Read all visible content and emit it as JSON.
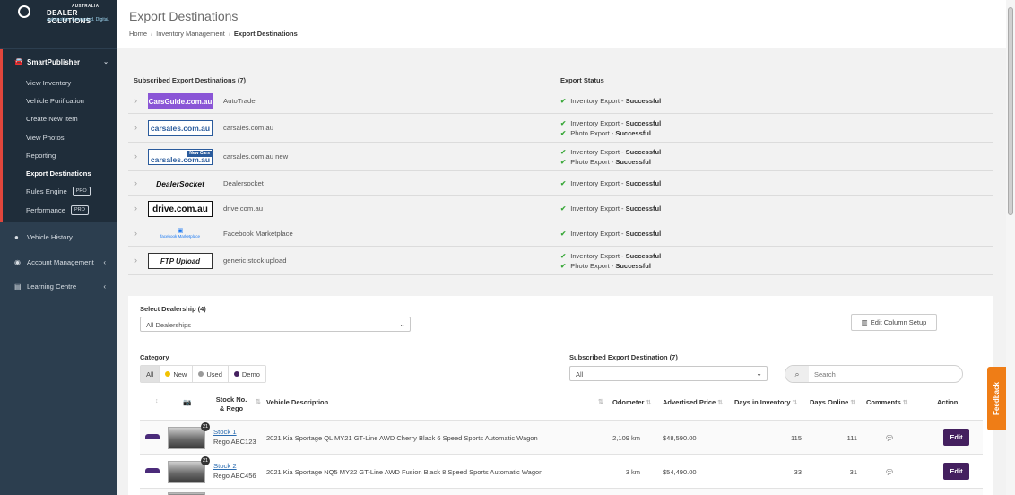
{
  "brand": {
    "country": "AUSTRALIA",
    "name": "DEALER SOLUTIONS",
    "tagline": "Automotive. Connected. Digital."
  },
  "sidebar": {
    "smart_publisher": "SmartPublisher",
    "items": [
      {
        "label": "View Inventory"
      },
      {
        "label": "Vehicle Purification"
      },
      {
        "label": "Create New Item"
      },
      {
        "label": "View Photos"
      },
      {
        "label": "Reporting"
      },
      {
        "label": "Export Destinations"
      },
      {
        "label": "Rules Engine",
        "badge": "PRO"
      },
      {
        "label": "Performance",
        "badge": "PRO"
      }
    ],
    "vehicle_history": "Vehicle History",
    "account_management": "Account Management",
    "learning_centre": "Learning Centre"
  },
  "header": {
    "title": "Export Destinations",
    "breadcrumb": [
      "Home",
      "Inventory Management",
      "Export Destinations"
    ]
  },
  "destinations": {
    "heading": "Subscribed Export Destinations (7)",
    "status_heading": "Export Status",
    "rows": [
      {
        "logo": "CarsGuide.com.au",
        "name": "AutoTrader",
        "status": [
          {
            "label": "Inventory Export - ",
            "value": "Successful"
          }
        ]
      },
      {
        "logo": "carsales.com.au",
        "name": "carsales.com.au",
        "status": [
          {
            "label": "Inventory Export - ",
            "value": "Successful"
          },
          {
            "label": "Photo Export - ",
            "value": "Successful"
          }
        ]
      },
      {
        "logo": "carsales.com.au",
        "logo_tag": "New Cars",
        "name": "carsales.com.au new",
        "status": [
          {
            "label": "Inventory Export - ",
            "value": "Successful"
          },
          {
            "label": "Photo Export - ",
            "value": "Successful"
          }
        ]
      },
      {
        "logo": "DealerSocket",
        "name": "Dealersocket",
        "status": [
          {
            "label": "Inventory Export - ",
            "value": "Successful"
          }
        ]
      },
      {
        "logo": "drive.com.au",
        "name": "drive.com.au",
        "status": [
          {
            "label": "Inventory Export - ",
            "value": "Successful"
          }
        ]
      },
      {
        "logo": "facebook Marketplace",
        "name": "Facebook Marketplace",
        "status": [
          {
            "label": "Inventory Export - ",
            "value": "Successful"
          }
        ]
      },
      {
        "logo": "FTP Upload",
        "name": "generic stock upload",
        "status": [
          {
            "label": "Inventory Export - ",
            "value": "Successful"
          },
          {
            "label": "Photo Export - ",
            "value": "Successful"
          }
        ]
      }
    ]
  },
  "filters": {
    "dealership_label": "Select Dealership (4)",
    "dealership_value": "All Dealerships",
    "edit_columns": "Edit Column Setup",
    "category_label": "Category",
    "categories": [
      {
        "label": "All",
        "color": ""
      },
      {
        "label": "New",
        "color": "#f2c200"
      },
      {
        "label": "Used",
        "color": "#9a9a9a"
      },
      {
        "label": "Demo",
        "color": "#44205f"
      }
    ],
    "destination_label": "Subscribed Export Destination (7)",
    "destination_value": "All",
    "search_placeholder": "Search"
  },
  "table": {
    "headers": {
      "stock": "Stock No. & Rego",
      "description": "Vehicle Description",
      "odometer": "Odometer",
      "price": "Advertised Price",
      "days_inventory": "Days in Inventory",
      "days_online": "Days Online",
      "comments": "Comments",
      "action": "Action"
    },
    "rows": [
      {
        "photos": "21",
        "stock": "Stock 1",
        "rego": "Rego ABC123",
        "description": "2021 Kia Sportage QL MY21 GT-Line AWD Cherry Black 6 Speed Sports Automatic Wagon",
        "odometer": "2,109 km",
        "price": "$48,590.00",
        "days_inventory": "115",
        "days_online": "111",
        "edit": "Edit"
      },
      {
        "photos": "21",
        "stock": "Stock 2",
        "rego": "Rego ABC456",
        "description": "2021 Kia Sportage NQ5 MY22 GT-Line AWD Fusion Black 8 Speed Sports Automatic Wagon",
        "odometer": "3 km",
        "price": "$54,490.00",
        "days_inventory": "33",
        "days_online": "31",
        "edit": "Edit"
      }
    ]
  },
  "feedback_label": "Feedback"
}
